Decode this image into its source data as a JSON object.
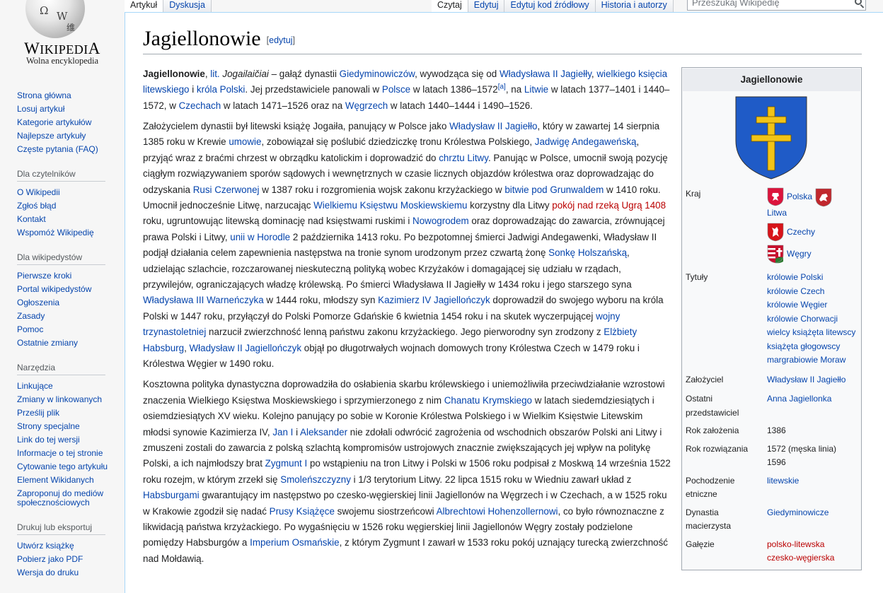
{
  "logo": {
    "wordmark_a": "W",
    "wordmark_b": "IKIPEDI",
    "wordmark_c": "A",
    "tagline": "Wolna encyklopedia",
    "globe_glyphs": [
      "Ω",
      "W",
      "维"
    ]
  },
  "tabs": {
    "left": [
      {
        "label": "Artykuł",
        "selected": true
      },
      {
        "label": "Dyskusja",
        "selected": false
      }
    ],
    "right": [
      {
        "label": "Czytaj",
        "selected": true
      },
      {
        "label": "Edytuj",
        "selected": false
      },
      {
        "label": "Edytuj kod źródłowy",
        "selected": false
      },
      {
        "label": "Historia i autorzy",
        "selected": false
      }
    ]
  },
  "search": {
    "placeholder": "Przeszukaj Wikipedię"
  },
  "sidebar": {
    "main": [
      "Strona główna",
      "Losuj artykuł",
      "Kategorie artykułów",
      "Najlepsze artykuły",
      "Częste pytania (FAQ)"
    ],
    "readers": {
      "heading": "Dla czytelników",
      "items": [
        "O Wikipedii",
        "Zgłoś błąd",
        "Kontakt",
        "Wspomóż Wikipedię"
      ]
    },
    "editors": {
      "heading": "Dla wikipedystów",
      "items": [
        "Pierwsze kroki",
        "Portal wikipedystów",
        "Ogłoszenia",
        "Zasady",
        "Pomoc",
        "Ostatnie zmiany"
      ]
    },
    "tools": {
      "heading": "Narzędzia",
      "items": [
        "Linkujące",
        "Zmiany w linkowanych",
        "Prześlij plik",
        "Strony specjalne",
        "Link do tej wersji",
        "Informacje o tej stronie",
        "Cytowanie tego artykułu",
        "Element Wikidanych",
        "Zaproponuj do mediów społecznościowych"
      ]
    },
    "print": {
      "heading": "Drukuj lub eksportuj",
      "items": [
        "Utwórz książkę",
        "Pobierz jako PDF",
        "Wersja do druku"
      ]
    }
  },
  "article": {
    "title": "Jagiellonowie",
    "edit_label": "[edytuj]",
    "paragraphs": [
      [
        {
          "t": "Jagiellonowie",
          "b": 1
        },
        {
          "t": ", "
        },
        {
          "t": "lit.",
          "l": 1
        },
        {
          "t": " "
        },
        {
          "t": "Jogailaičiai",
          "i": 1
        },
        {
          "t": " – gałąź dynastii "
        },
        {
          "t": "Giedyminowiczów",
          "l": 1
        },
        {
          "t": ", wywodząca się od "
        },
        {
          "t": "Władysława II Jagiełły",
          "l": 1
        },
        {
          "t": ", "
        },
        {
          "t": "wielkiego księcia litewskiego",
          "l": 1
        },
        {
          "t": " i "
        },
        {
          "t": "króla Polski",
          "l": 1
        },
        {
          "t": ". Jej przedstawiciele panowali w "
        },
        {
          "t": "Polsce",
          "l": 1
        },
        {
          "t": " w latach 1386–1572"
        },
        {
          "t": "[a]",
          "l": 1,
          "sup": 1
        },
        {
          "t": ", na "
        },
        {
          "t": "Litwie",
          "l": 1
        },
        {
          "t": " w latach 1377–1401 i 1440–1572, w "
        },
        {
          "t": "Czechach",
          "l": 1
        },
        {
          "t": " w latach 1471–1526 oraz na "
        },
        {
          "t": "Węgrzech",
          "l": 1
        },
        {
          "t": " w latach 1440–1444 i 1490–1526."
        }
      ],
      [
        {
          "t": "Założycielem dynastii był litewski książę Jogaiła, panujący w Polsce jako "
        },
        {
          "t": "Władysław II Jagiełło",
          "l": 1
        },
        {
          "t": ", który w zawartej 14 sierpnia 1385 roku w Krewie "
        },
        {
          "t": "umowie",
          "l": 1
        },
        {
          "t": ", zobowiązał się poślubić dziedziczkę tronu Królestwa Polskiego, "
        },
        {
          "t": "Jadwigę Andegaweńską",
          "l": 1
        },
        {
          "t": ", przyjąć wraz z braćmi chrzest w obrządku katolickim i doprowadzić do "
        },
        {
          "t": "chrztu Litwy",
          "l": 1
        },
        {
          "t": ". Panując w Polsce, umocnił swoją pozycję ciągłym rozwiązywaniem sporów sądowych i wewnętrznych w czasie licznych objazdów królestwa oraz doprowadzając do odzyskania "
        },
        {
          "t": "Rusi Czerwonej",
          "l": 1
        },
        {
          "t": " w 1387 roku i rozgromienia wojsk zakonu krzyżackiego w "
        },
        {
          "t": "bitwie pod Grunwaldem",
          "l": 1
        },
        {
          "t": " w 1410 roku. Umocnił jednocześnie Litwę, narzucając "
        },
        {
          "t": "Wielkiemu Księstwu Moskiewskiemu",
          "l": 1
        },
        {
          "t": " korzystny dla Litwy "
        },
        {
          "t": "pokój nad rzeką Ugrą 1408",
          "r": 1
        },
        {
          "t": " roku, ugruntowując litewską dominację nad księstwami ruskimi i "
        },
        {
          "t": "Nowogrodem",
          "l": 1
        },
        {
          "t": " oraz doprowadzając do zawarcia, zrównującej prawa Polski i Litwy, "
        },
        {
          "t": "unii w Horodle",
          "l": 1
        },
        {
          "t": " 2 października 1413 roku. Po bezpotomnej śmierci Jadwigi Andegawenki, Władysław II podjął działania celem zapewnienia następstwa na tronie synom urodzonym przez czwartą żonę "
        },
        {
          "t": "Sonkę Holszańską",
          "l": 1
        },
        {
          "t": ", udzielając szlachcie, rozczarowanej nieskuteczną polityką wobec Krzyżaków i domagającej się udziału w rządach, przywilejów, ograniczających władzę królewską. Po śmierci Władysława II Jagiełły w 1434 roku i jego starszego syna "
        },
        {
          "t": "Władysława III Warneńczyka",
          "l": 1
        },
        {
          "t": " w 1444 roku, młodszy syn "
        },
        {
          "t": "Kazimierz IV Jagiellończyk",
          "l": 1
        },
        {
          "t": " doprowadził do swojego wyboru na króla Polski w 1447 roku, przyłączył do Polski Pomorze Gdańskie 6 kwietnia 1454 roku i na skutek wyczerpującej "
        },
        {
          "t": "wojny trzynastoletniej",
          "l": 1
        },
        {
          "t": " narzucił zwierzchność lenną państwu zakonu krzyżackiego. Jego pierworodny syn zrodzony z "
        },
        {
          "t": "Elżbiety Habsburg",
          "l": 1
        },
        {
          "t": ", "
        },
        {
          "t": "Władysław II Jagiellończyk",
          "l": 1
        },
        {
          "t": " objął po długotrwałych wojnach domowych trony Królestwa Czech w 1479 roku i Królestwa Węgier w 1490 roku."
        }
      ],
      [
        {
          "t": "Kosztowna polityka dynastyczna doprowadziła do osłabienia skarbu królewskiego i uniemożliwiła przeciwdziałanie wzrostowi znaczenia Wielkiego Księstwa Moskiewskiego i sprzymierzonego z nim "
        },
        {
          "t": "Chanatu Krymskiego",
          "l": 1
        },
        {
          "t": " w latach siedemdziesiątych i osiemdziesiątych XV wieku. Kolejno panujący po sobie w Koronie Królestwa Polskiego i w Wielkim Księstwie Litewskim młodsi synowie Kazimierza IV, "
        },
        {
          "t": "Jan I",
          "l": 1
        },
        {
          "t": " i "
        },
        {
          "t": "Aleksander",
          "l": 1
        },
        {
          "t": " nie zdołali odwrócić zagrożenia od wschodnich obszarów Polski ani Litwy i zmuszeni zostali do zawarcia z polską szlachtą kompromisów ustrojowych znacznie zwiększających jej wpływ na politykę Polski, a ich najmłodszy brat "
        },
        {
          "t": "Zygmunt I",
          "l": 1
        },
        {
          "t": " po wstąpieniu na tron Litwy i Polski w 1506 roku podpisał z Moskwą 14 września 1522 roku rozejm, w którym zrzekł się "
        },
        {
          "t": "Smoleńszczyzny",
          "l": 1
        },
        {
          "t": " i 1/3 terytorium Litwy. 22 lipca 1515 roku w Wiedniu zawarł układ z "
        },
        {
          "t": "Habsburgami",
          "l": 1
        },
        {
          "t": " gwarantujący im następstwo po czesko-węgierskiej linii Jagiellonów na Węgrzech i w Czechach, a w 1525 roku w Krakowie zgodził się nadać "
        },
        {
          "t": "Prusy Książęce",
          "l": 1
        },
        {
          "t": " swojemu siostrzeńcowi "
        },
        {
          "t": "Albrechtowi Hohenzollernowi",
          "l": 1
        },
        {
          "t": ", co było równoznaczne z likwidacją państwa krzyżackiego. Po wygaśnięciu w 1526 roku węgierskiej linii Jagiellonów Węgry zostały podzielone pomiędzy Habsburgów a "
        },
        {
          "t": "Imperium Osmańskie",
          "l": 1
        },
        {
          "t": ", z którym Zygmunt I zawarł w 1533 roku pokój uznający turecką zwierzchność nad Mołdawią."
        }
      ]
    ]
  },
  "infobox": {
    "title": "Jagiellonowie",
    "colors": {
      "shield": "#1f5bc7",
      "cross": "#f2c417"
    },
    "rows": [
      {
        "key": "Kraj",
        "type": "flags",
        "values": [
          {
            "flag": "poland",
            "label": "Polska"
          },
          {
            "flag": "lithuania",
            "label": "Litwa"
          },
          {
            "flag": "czech",
            "label": "Czechy"
          },
          {
            "flag": "hungary",
            "label": "Węgry"
          }
        ]
      },
      {
        "key": "Tytuły",
        "type": "links",
        "values": [
          "królowie Polski",
          "królowie Czech",
          "królowie Węgier",
          "królowie Chorwacji",
          "wielcy książęta litewscy",
          "książęta głogowscy",
          "margrabiowie Moraw"
        ]
      },
      {
        "key": "Założyciel",
        "type": "links",
        "values": [
          "Władysław II Jagiełło"
        ]
      },
      {
        "key": "Ostatni przedstawiciel",
        "type": "links",
        "values": [
          "Anna Jagiellonka"
        ]
      },
      {
        "key": "Rok założenia",
        "type": "text",
        "values": [
          "1386"
        ]
      },
      {
        "key": "Rok rozwiązania",
        "type": "text",
        "values": [
          "1572 (męska linia) 1596"
        ]
      },
      {
        "key": "Pochodzenie etniczne",
        "type": "links",
        "values": [
          "litewskie"
        ]
      },
      {
        "key": "Dynastia macierzysta",
        "type": "links",
        "values": [
          "Giedyminowicze"
        ]
      },
      {
        "key": "Gałęzie",
        "type": "red",
        "values": [
          "polsko-litewska",
          "czesko-węgierska"
        ]
      }
    ]
  }
}
